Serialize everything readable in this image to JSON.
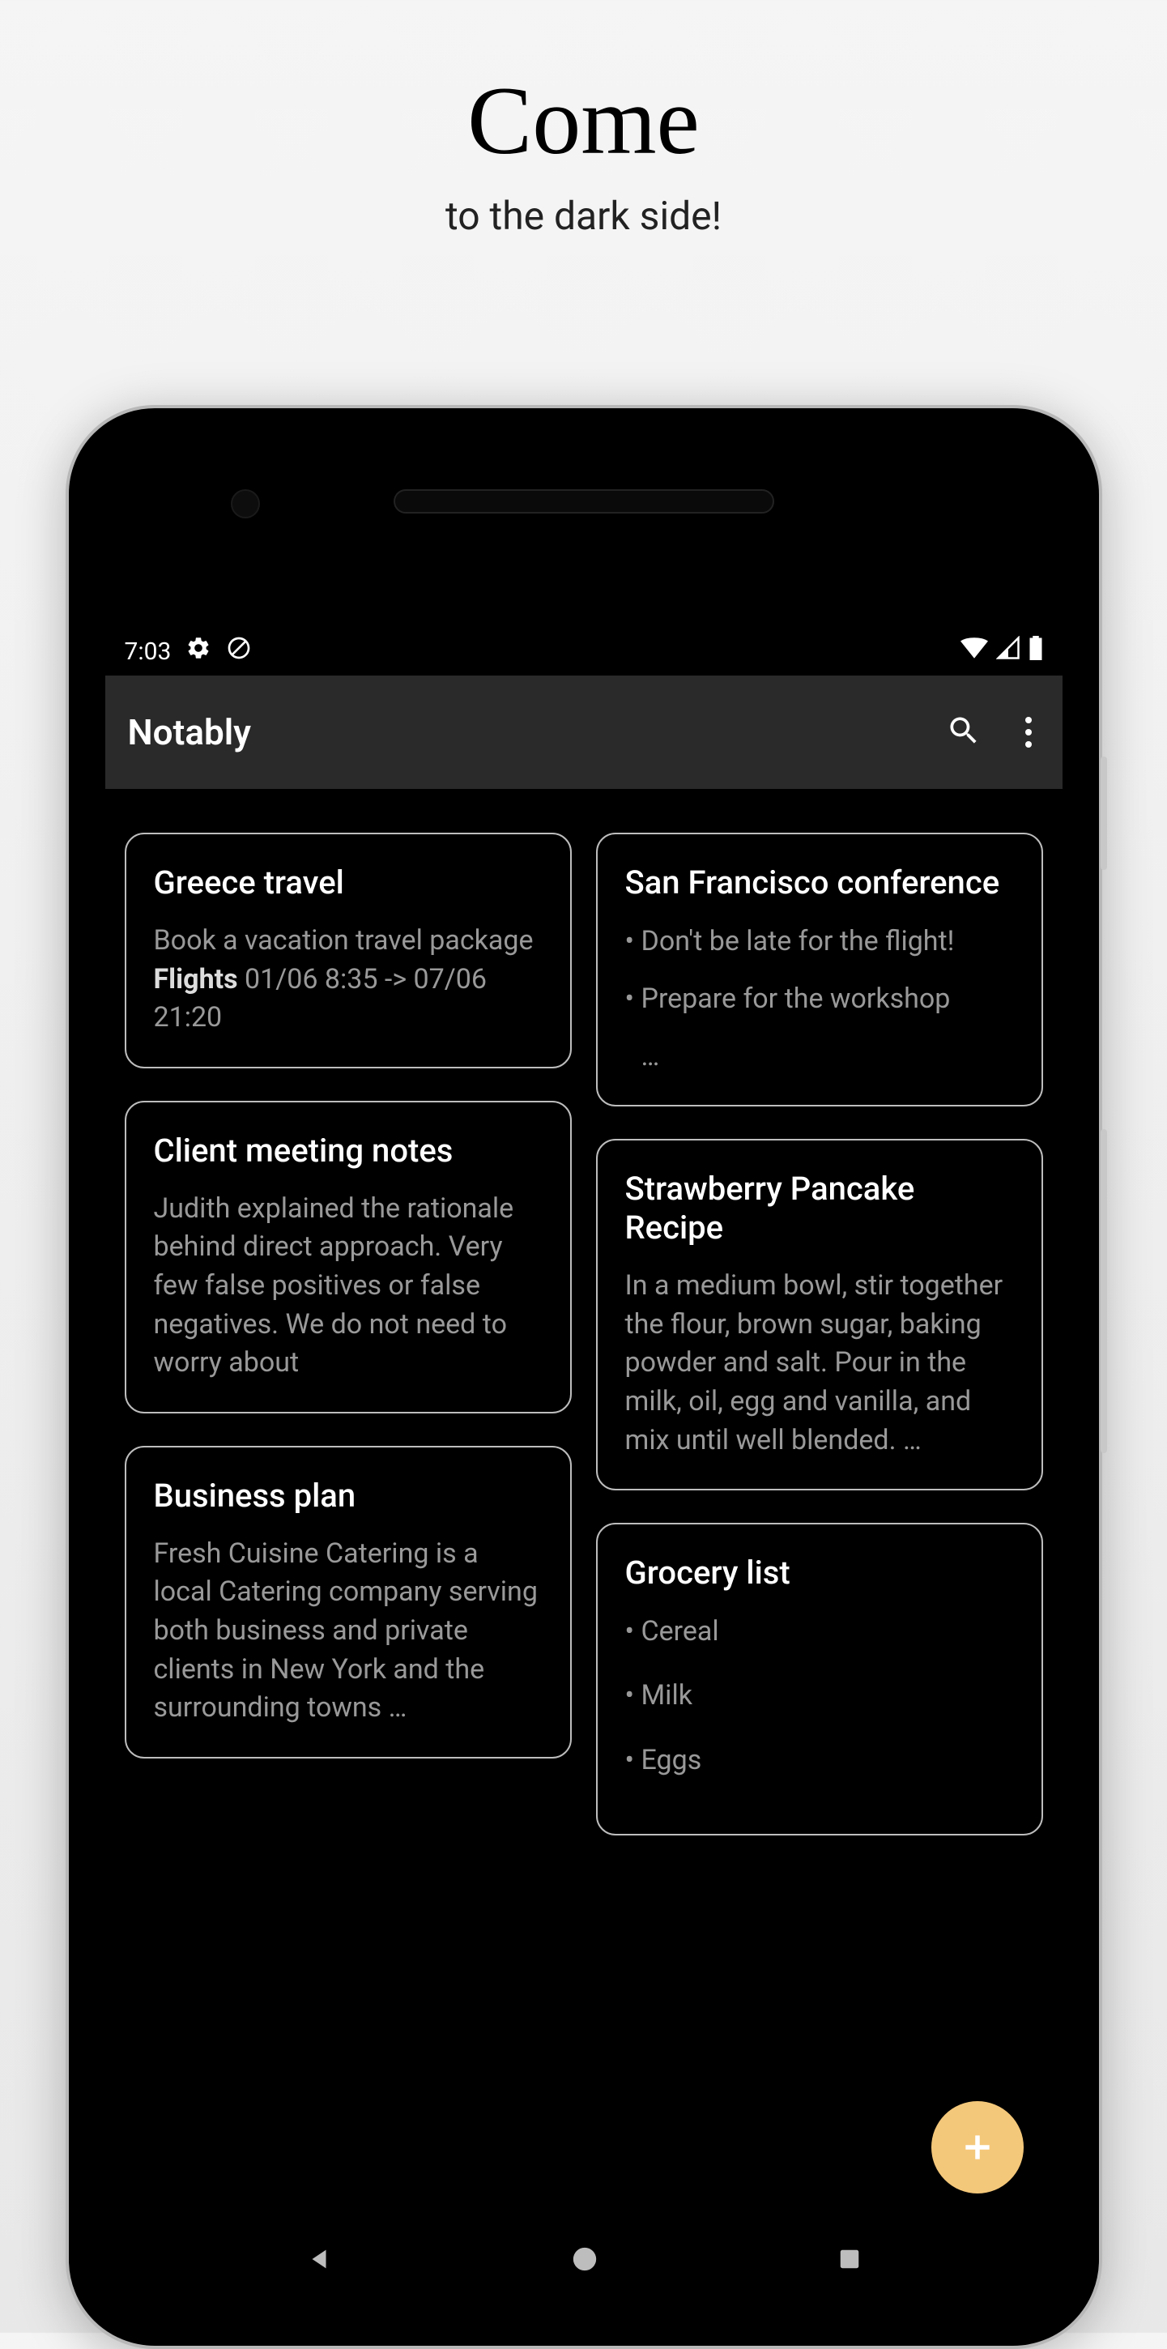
{
  "hero": {
    "title": "Come",
    "subtitle": "to the dark side!"
  },
  "status": {
    "time": "7:03"
  },
  "app": {
    "title": "Notably"
  },
  "notes": {
    "left": [
      {
        "title": "Greece travel",
        "body_plain": "Book a vacation travel package",
        "body_bold": "Flights",
        "body_after": " 01/06 8:35 -> 07/06 21:20"
      },
      {
        "title": "Client meeting notes",
        "body": "Judith explained the rationale behind direct approach. Very few false positives or false negatives. We do not need to worry about"
      },
      {
        "title": "Business plan",
        "body": "Fresh Cuisine Catering is a local Catering company serving both business and private clients in New York and the surrounding towns …"
      }
    ],
    "right": [
      {
        "title": "San Francisco conference",
        "bullets": [
          "Don't be late for the flight!",
          "Prepare for the workshop"
        ],
        "trail": "…"
      },
      {
        "title": "Strawberry Pancake Recipe",
        "body": "In a medium bowl, stir together the flour,  brown sugar, baking powder and salt. Pour in the milk, oil, egg and vanilla, and mix until well blended. …"
      },
      {
        "title": "Grocery list",
        "bullets": [
          "Cereal",
          "Milk",
          "Eggs"
        ]
      }
    ]
  }
}
